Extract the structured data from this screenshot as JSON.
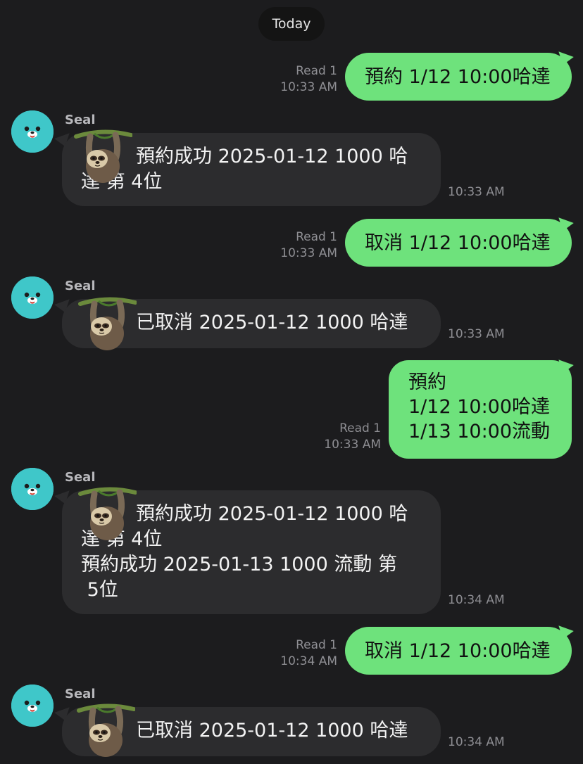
{
  "date_separator": "Today",
  "messages": [
    {
      "direction": "out",
      "read": "Read 1",
      "time": "10:33 AM",
      "text": "預約 1/12 10:00哈達"
    },
    {
      "direction": "in",
      "sender": "Seal",
      "lines": [
        "預約成功 2025-01-12 1000 哈",
        "達 第 4位"
      ],
      "time": "10:33 AM",
      "sticker": "sloth-sticker"
    },
    {
      "direction": "out",
      "read": "Read 1",
      "time": "10:33 AM",
      "text": "取消 1/12 10:00哈達"
    },
    {
      "direction": "in",
      "sender": "Seal",
      "lines": [
        "已取消 2025-01-12 1000 哈達"
      ],
      "time": "10:33 AM",
      "sticker": "sloth-sticker"
    },
    {
      "direction": "out",
      "read": "Read 1",
      "time": "10:33 AM",
      "text": "預約\n1/12 10:00哈達\n1/13 10:00流動"
    },
    {
      "direction": "in",
      "sender": "Seal",
      "lines": [
        "預約成功 2025-01-12 1000 哈",
        "達 第 4位",
        "預約成功 2025-01-13 1000 流動 第",
        " 5位"
      ],
      "time": "10:34 AM",
      "sticker": "sloth-sticker"
    },
    {
      "direction": "out",
      "read": "Read 1",
      "time": "10:34 AM",
      "text": "取消 1/12 10:00哈達"
    },
    {
      "direction": "in",
      "sender": "Seal",
      "lines": [
        "已取消 2025-01-12 1000 哈達"
      ],
      "time": "10:34 AM",
      "sticker": "sloth-sticker"
    }
  ],
  "colors": {
    "background": "#1c1c1e",
    "outgoing_bubble": "#6ee27c",
    "incoming_bubble": "#2c2c2e",
    "avatar": "#3fc7c9"
  },
  "icons": {
    "avatar": "seal-avatar-icon",
    "sticker": "sloth-sticker"
  }
}
